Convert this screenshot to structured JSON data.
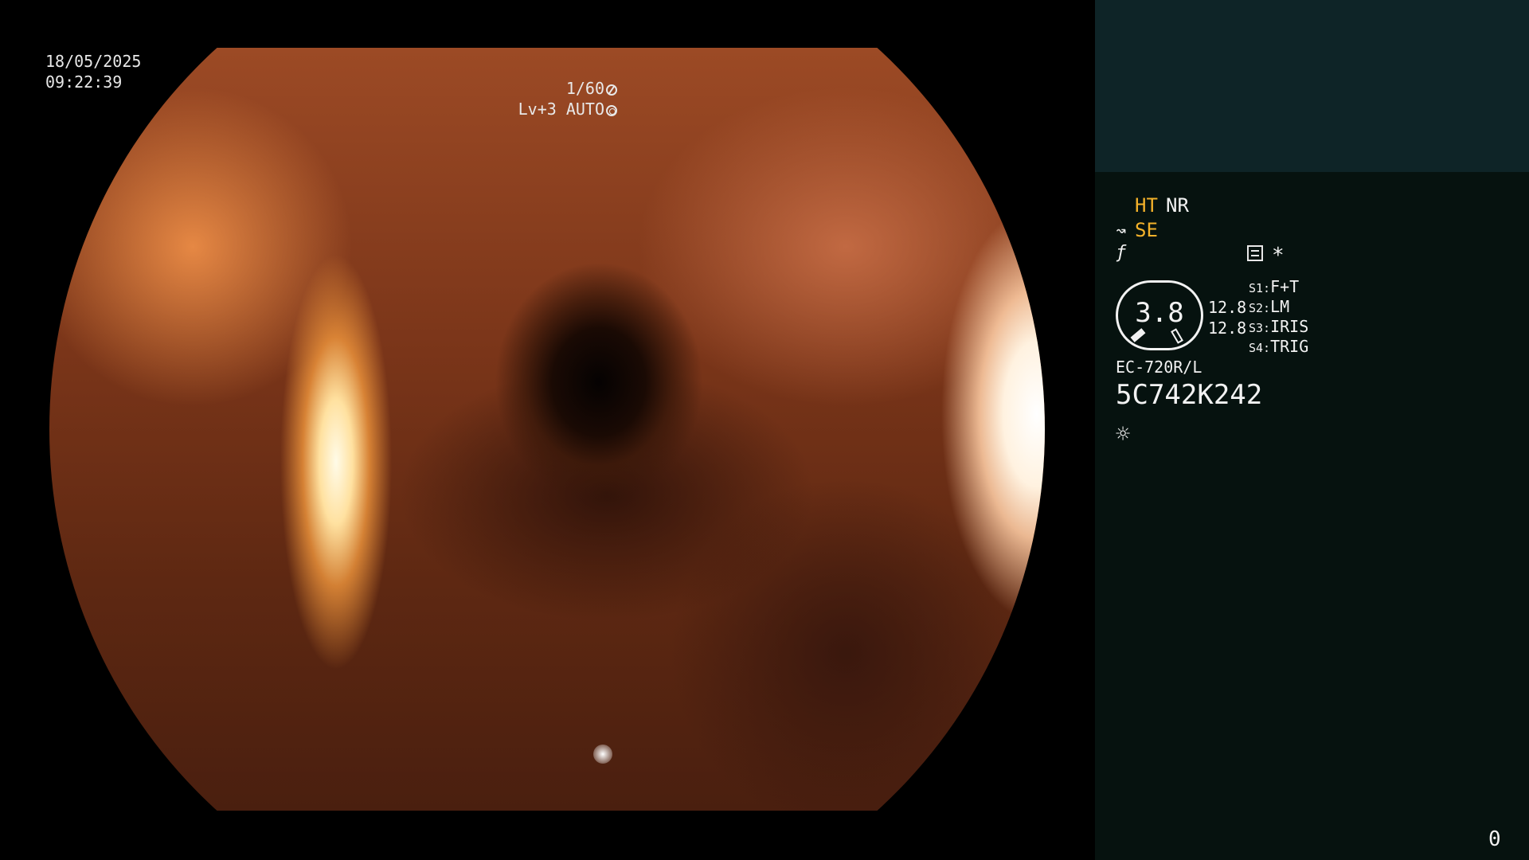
{
  "viewport": {
    "date": "18/05/2025",
    "time": "09:22:39",
    "shutter": "1/60",
    "exposure_level": "Lv+3 AUTO"
  },
  "panel": {
    "ht": "HT",
    "nr": "NR",
    "se": "SE",
    "gauge_value": "3.8",
    "pressure_1": "12.8",
    "pressure_2": "12.8",
    "switches": [
      {
        "key": "S1:",
        "value": "F+T"
      },
      {
        "key": "S2:",
        "value": "LM"
      },
      {
        "key": "S3:",
        "value": "IRIS"
      },
      {
        "key": "S4:",
        "value": "TRIG"
      }
    ],
    "scope_model": "EC-720R/L",
    "scope_serial": "5C742K242",
    "counter": "0"
  },
  "colors": {
    "accent": "#f3b12a",
    "panel_bg": "#06120f",
    "patient_box_bg": "#0e2427",
    "text": "#f2f2f2"
  },
  "icons": {
    "shutter": "shutter-icon",
    "iris": "iris-icon",
    "structure_enhance": "structure-enhance-icon",
    "enhancement": "enhancement-icon",
    "menu": "menu-icon",
    "capture": "asterisk-icon",
    "light": "light-source-icon"
  }
}
